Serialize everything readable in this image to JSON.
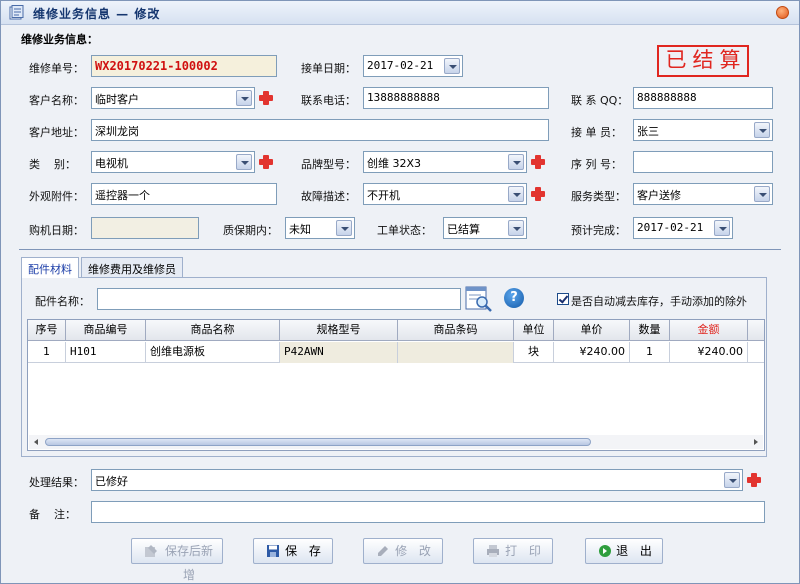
{
  "window": {
    "title": "维修业务信息 — 修改"
  },
  "section_label": "维修业务信息：",
  "status_stamp": "已结算",
  "form": {
    "order_no": {
      "label": "维修单号：",
      "value": "WX20170221-100002"
    },
    "receive_date": {
      "label": "接单日期：",
      "value": "2017-02-21"
    },
    "customer_name": {
      "label": "客户名称：",
      "value": "临时客户"
    },
    "phone": {
      "label": "联系电话：",
      "value": "13888888888"
    },
    "qq": {
      "label": "联 系 QQ：",
      "value": "888888888"
    },
    "address": {
      "label": "客户地址：",
      "value": "深圳龙岗"
    },
    "receiver": {
      "label": "接 单 员：",
      "value": "张三"
    },
    "category": {
      "label": "类    别：",
      "value": "电视机"
    },
    "brand_model": {
      "label": "品牌型号：",
      "value": "创维 32X3"
    },
    "serial_no": {
      "label": "序 列 号：",
      "value": ""
    },
    "accessories": {
      "label": "外观附件：",
      "value": "遥控器一个"
    },
    "fault": {
      "label": "故障描述：",
      "value": "不开机"
    },
    "service_type": {
      "label": "服务类型：",
      "value": "客户送修"
    },
    "purchase_date": {
      "label": "购机日期：",
      "value": ""
    },
    "warranty": {
      "label": "质保期内：",
      "value": "未知"
    },
    "order_status": {
      "label": "工单状态：",
      "value": "已结算"
    },
    "expected_finish": {
      "label": "预计完成：",
      "value": "2017-02-21"
    }
  },
  "tabs": [
    {
      "label": "配件材料"
    },
    {
      "label": "维修费用及维修员"
    }
  ],
  "parts": {
    "name_label": "配件名称：",
    "name_value": "",
    "auto_deduct_label": "是否自动减去库存，手动添加的除外",
    "auto_deduct_checked": true,
    "columns": [
      "序号",
      "商品编号",
      "商品名称",
      "规格型号",
      "商品条码",
      "单位",
      "单价",
      "数量",
      "金额"
    ],
    "rows": [
      {
        "seq": "1",
        "code": "H101",
        "name": "创维电源板",
        "spec": "P42AWN",
        "barcode": "",
        "unit": "块",
        "price": "¥240.00",
        "qty": "1",
        "amount": "¥240.00"
      }
    ]
  },
  "result": {
    "label": "处理结果：",
    "value": "已修好"
  },
  "remark": {
    "label": "备    注：",
    "value": ""
  },
  "buttons": {
    "save_new": "保存后新增",
    "save": "保 存",
    "edit": "修 改",
    "print": "打 印",
    "exit": "退 出"
  },
  "colors": {
    "stamp": "#e0261f",
    "accent": "#1c3ea8"
  }
}
